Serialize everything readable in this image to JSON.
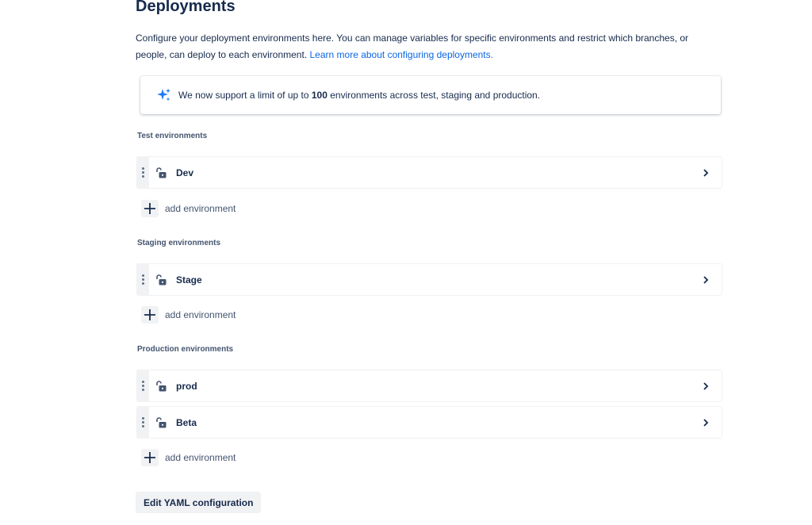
{
  "page": {
    "title": "Deployments",
    "description_text": "Configure your deployment environments here. You can manage variables for specific environments and restrict which branches, or people, can deploy to each environment.",
    "learn_more_link": "Learn more about configuring deployments."
  },
  "banner": {
    "icon": "sparkle-icon",
    "text_before": "We now support a limit of up to",
    "highlight": "100",
    "text_after": "environments across test, staging and production."
  },
  "sections": [
    {
      "label": "Test environments",
      "environments": [
        {
          "name": "Dev"
        }
      ],
      "add_label": "add environment"
    },
    {
      "label": "Staging environments",
      "environments": [
        {
          "name": "Stage"
        }
      ],
      "add_label": "add environment"
    },
    {
      "label": "Production environments",
      "environments": [
        {
          "name": "prod"
        },
        {
          "name": "Beta"
        }
      ],
      "add_label": "add environment"
    }
  ],
  "footer": {
    "yaml_button": "Edit YAML configuration"
  },
  "colors": {
    "text": "#172b4d",
    "link": "#0c66e4",
    "sparkle": "#1d7afc",
    "subtle": "#44546f"
  }
}
